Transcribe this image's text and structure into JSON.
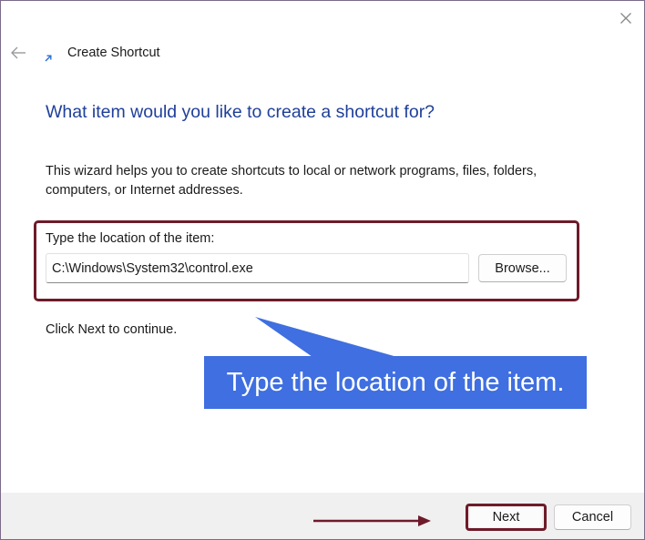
{
  "window": {
    "title": "Create Shortcut",
    "icons": {
      "close": "close-icon",
      "back": "back-arrow-icon",
      "title": "shortcut-icon"
    }
  },
  "main": {
    "heading": "What item would you like to create a shortcut for?",
    "intro": "This wizard helps you to create shortcuts to local or network programs, files, folders, computers, or Internet addresses.",
    "location_label": "Type the location of the item:",
    "location_value": "C:\\Windows\\System32\\control.exe",
    "browse_label": "Browse...",
    "click_next": "Click Next to continue."
  },
  "annotation": {
    "callout_text": "Type the location of the item.",
    "callout_color": "#3f6fe0",
    "highlight_color": "#6e1a2a"
  },
  "footer": {
    "next_label": "Next",
    "cancel_label": "Cancel"
  },
  "colors": {
    "heading": "#1f3f9a",
    "footer_bg": "#f0f0f0"
  }
}
